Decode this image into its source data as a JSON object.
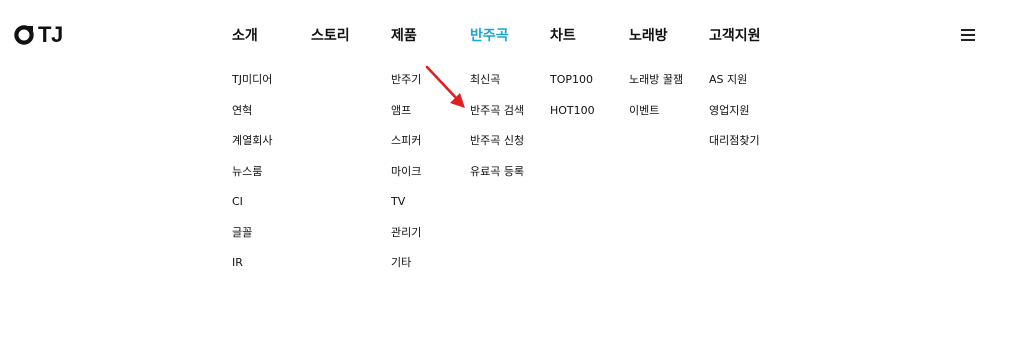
{
  "logo": {
    "text": "TJ",
    "icon": "tj-logo-icon"
  },
  "nav": {
    "columns": [
      {
        "label": "소개",
        "active": false,
        "items": [
          "TJ미디어",
          "연혁",
          "계열회사",
          "뉴스룸",
          "CI",
          "글꼴",
          "IR"
        ]
      },
      {
        "label": "스토리",
        "active": false,
        "items": []
      },
      {
        "label": "제품",
        "active": false,
        "items": [
          "반주기",
          "앰프",
          "스피커",
          "마이크",
          "TV",
          "관리기",
          "기타"
        ]
      },
      {
        "label": "반주곡",
        "active": true,
        "items": [
          "최신곡",
          "반주곡 검색",
          "반주곡 신청",
          "유료곡 등록"
        ]
      },
      {
        "label": "차트",
        "active": false,
        "items": [
          "TOP100",
          "HOT100"
        ]
      },
      {
        "label": "노래방",
        "active": false,
        "items": [
          "노래방 꿀잼",
          "이벤트"
        ]
      },
      {
        "label": "고객지원",
        "active": false,
        "items": [
          "AS 지원",
          "영업지원",
          "대리점찾기"
        ]
      }
    ]
  },
  "menu_icon": "hamburger-menu-icon",
  "annotation": {
    "icon": "red-arrow-icon",
    "color": "#e02020"
  },
  "colors": {
    "accent": "#16a7d6",
    "text": "#111111",
    "arrow": "#e02020"
  }
}
